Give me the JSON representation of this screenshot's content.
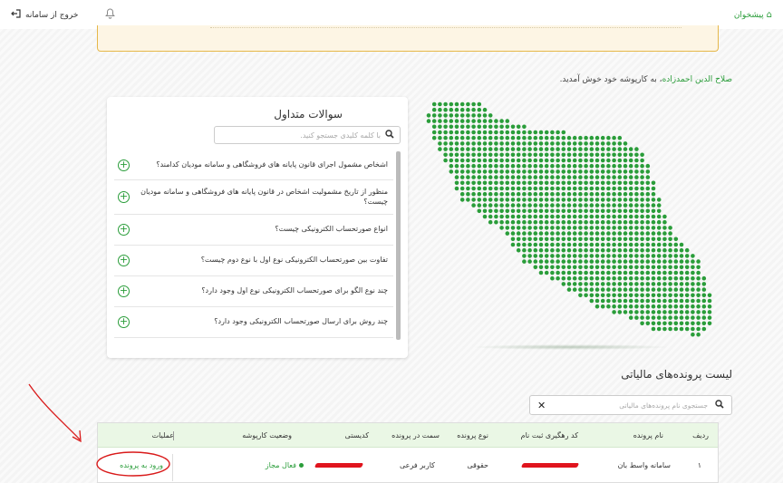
{
  "header": {
    "home_label": "پیشخوان",
    "logout_label": "خروج از سامانه"
  },
  "welcome": {
    "user_name": "صلاح الدین احمدزاده",
    "text": "، به کارپوشه خود خوش آمدید."
  },
  "faq": {
    "title": "سوالات متداول",
    "search_placeholder": "با کلمه کلیدی جستجو کنید.",
    "items": [
      "اشخاص مشمول اجرای قانون پایانه های فروشگاهی و سامانه مودیان کدامند؟",
      "منظور از تاریخ مشمولیت اشخاص در قانون پایانه های فروشگاهی و سامانه مودیان چیست؟",
      "انواع صورتحساب الکترونیکی چیست؟",
      "تفاوت بین صورتحساب الکترونیکی نوع اول با نوع دوم چیست؟",
      "چند نوع الگو برای صورتحساب الکترونیکی نوع اول وجود دارد؟",
      "چند روش برای ارسال صورتحساب الکترونیکی وجود دارد؟"
    ]
  },
  "files": {
    "title": "لیست پرونده‌های مالیاتی",
    "search_placeholder": "جستجوی نام پرونده‌های مالیاتی",
    "columns": [
      "ردیف",
      "نام پرونده",
      "کد رهگیری ثبت نام",
      "نوع پرونده",
      "سمت در پرونده",
      "کدیستی",
      "وضعیت کارپوشه",
      "عملیات"
    ],
    "rows": [
      {
        "index": "۱",
        "name": "سامانه واسط بان",
        "type": "حقوقی",
        "role": "کاربر فرعی",
        "status": "فعال مجاز",
        "action": "ورود به پرونده"
      }
    ]
  },
  "colors": {
    "accent": "#2a9d3a",
    "alert_bg": "#fdf5e4",
    "alert_border": "#e6b84a",
    "table_header": "#eaf7e5",
    "redaction": "#e0141d"
  }
}
